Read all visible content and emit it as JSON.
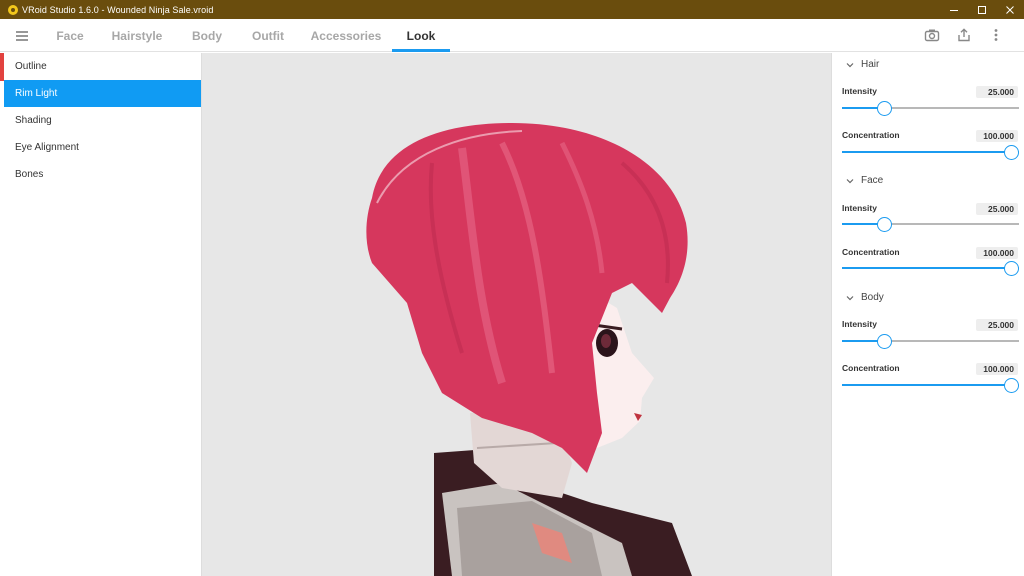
{
  "window": {
    "title": "VRoid Studio 1.6.0 - Wounded Ninja Sale.vroid",
    "controls": [
      "minimize-icon",
      "maximize-icon",
      "close-icon"
    ]
  },
  "tabs": [
    {
      "label": "Face",
      "active": false
    },
    {
      "label": "Hairstyle",
      "active": false
    },
    {
      "label": "Body",
      "active": false
    },
    {
      "label": "Outfit",
      "active": false
    },
    {
      "label": "Accessories",
      "active": false
    },
    {
      "label": "Look",
      "active": true
    }
  ],
  "toolbar_icons": [
    "camera-icon",
    "export-icon",
    "more-vertical-icon"
  ],
  "sidebar": {
    "items": [
      {
        "label": "Outline",
        "active": false
      },
      {
        "label": "Rim Light",
        "active": true
      },
      {
        "label": "Shading",
        "active": false
      },
      {
        "label": "Eye Alignment",
        "active": false
      },
      {
        "label": "Bones",
        "active": false
      }
    ]
  },
  "panel": {
    "sections": [
      {
        "title": "Hair",
        "params": [
          {
            "label": "Intensity",
            "value": "25.000",
            "fraction": 0.25
          },
          {
            "label": "Concentration",
            "value": "100.000",
            "fraction": 1.0
          }
        ]
      },
      {
        "title": "Face",
        "params": [
          {
            "label": "Intensity",
            "value": "25.000",
            "fraction": 0.25
          },
          {
            "label": "Concentration",
            "value": "100.000",
            "fraction": 1.0
          }
        ]
      },
      {
        "title": "Body",
        "params": [
          {
            "label": "Intensity",
            "value": "25.000",
            "fraction": 0.25
          },
          {
            "label": "Concentration",
            "value": "100.000",
            "fraction": 1.0
          }
        ]
      }
    ]
  },
  "colors": {
    "titlebar": "#6a4d0d",
    "accent": "#1b9bf0",
    "sidebar_active": "#109bf3",
    "viewport_bg": "#e7e7e7",
    "hair": "#d6375d"
  }
}
